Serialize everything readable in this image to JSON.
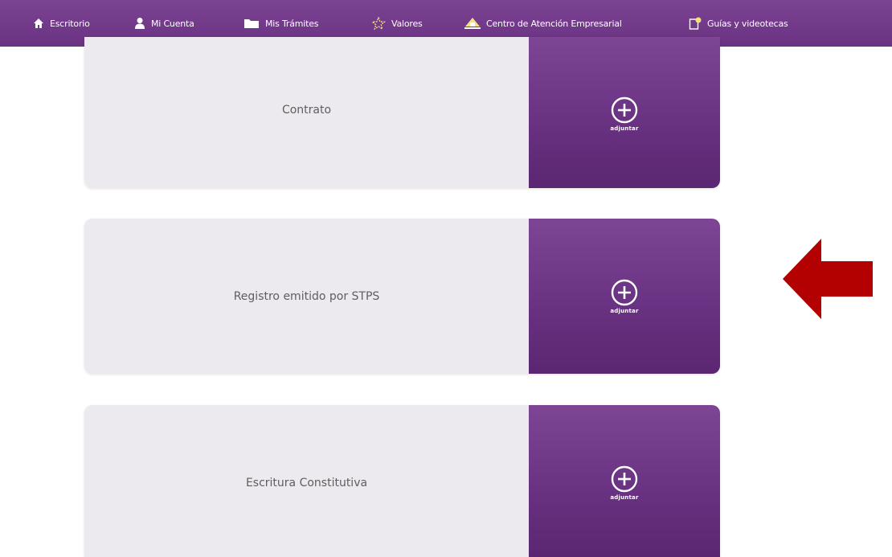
{
  "nav": {
    "items": [
      {
        "label": "Escritorio",
        "icon": "home-icon"
      },
      {
        "label": "Mi Cuenta",
        "icon": "user-icon"
      },
      {
        "label": "Mis Trámites",
        "icon": "folder-icon"
      },
      {
        "label": "Valores",
        "icon": "star-icon"
      },
      {
        "label": "Centro de Atención Empresarial",
        "icon": "building-icon"
      },
      {
        "label": "Guías y videotecas",
        "icon": "guide-icon"
      }
    ],
    "bar_color": "#6f3787"
  },
  "documents": [
    {
      "label": "Contrato",
      "action_label": "adjuntar"
    },
    {
      "label": "Registro emitido por STPS",
      "action_label": "adjuntar"
    },
    {
      "label": "Escritura Constitutiva",
      "action_label": "adjuntar"
    }
  ],
  "annotation": {
    "arrow_color": "#b30000",
    "points_to": "Registro emitido por STPS"
  }
}
